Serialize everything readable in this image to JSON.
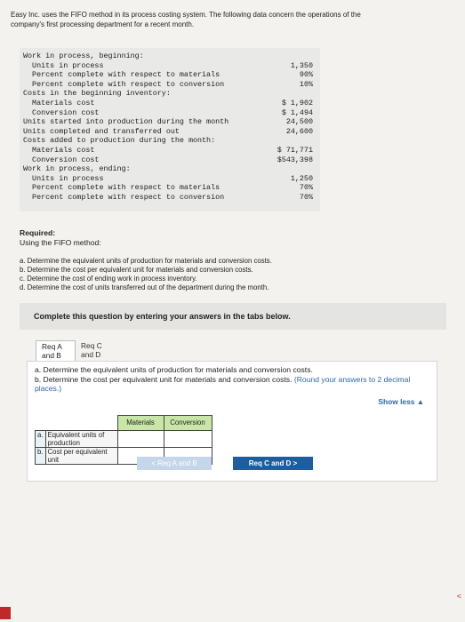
{
  "intro": {
    "line1": "Easy Inc. uses the FIFO method in its process costing system. The following data concern the operations of the",
    "line2": "company's first processing department for a recent month."
  },
  "data_rows": [
    {
      "label": "Work in process, beginning:",
      "value": "",
      "indent": 0
    },
    {
      "label": "  Units in process",
      "value": "1,350",
      "indent": 0
    },
    {
      "label": "  Percent complete with respect to materials",
      "value": "90%",
      "indent": 0
    },
    {
      "label": "  Percent complete with respect to conversion",
      "value": "10%",
      "indent": 0
    },
    {
      "label": "Costs in the beginning inventory:",
      "value": "",
      "indent": 0
    },
    {
      "label": "  Materials cost",
      "value": "$ 1,902",
      "indent": 0
    },
    {
      "label": "  Conversion cost",
      "value": "$ 1,494",
      "indent": 0
    },
    {
      "label": "Units started into production during the month",
      "value": "24,500",
      "indent": 0
    },
    {
      "label": "Units completed and transferred out",
      "value": "24,600",
      "indent": 0
    },
    {
      "label": "Costs added to production during the month:",
      "value": "",
      "indent": 0
    },
    {
      "label": "  Materials cost",
      "value": "$ 71,771",
      "indent": 0
    },
    {
      "label": "  Conversion cost",
      "value": "$543,398",
      "indent": 0
    },
    {
      "label": "Work in process, ending:",
      "value": "",
      "indent": 0
    },
    {
      "label": "  Units in process",
      "value": "1,250",
      "indent": 0
    },
    {
      "label": "  Percent complete with respect to materials",
      "value": "70%",
      "indent": 0
    },
    {
      "label": "  Percent complete with respect to conversion",
      "value": "70%",
      "indent": 0
    }
  ],
  "required": {
    "heading": "Required:",
    "subheading": "Using the FIFO method:",
    "items": [
      "a. Determine the equivalent units of production for materials and conversion costs.",
      "b. Determine the cost per equivalent unit for materials and conversion costs.",
      "c. Determine the cost of ending work in process inventory.",
      "d. Determine the cost of units transferred out of the department during the month."
    ]
  },
  "panel_title": "Complete this question by entering your answers in the tabs below.",
  "tabs": [
    {
      "line1": "Req A",
      "line2": "and B"
    },
    {
      "line1": "Req C",
      "line2": "and D"
    }
  ],
  "question": {
    "text": "a. Determine the equivalent units of production for materials and conversion costs.",
    "text2": "b. Determine the cost per equivalent unit for materials and conversion costs.",
    "hint": "(Round your answers to 2 decimal places.)",
    "show_less": "Show less ▲"
  },
  "answer_table": {
    "col_materials": "Materials",
    "col_conversion": "Conversion",
    "rows": [
      {
        "key": "a.",
        "label": "Equivalent units of production"
      },
      {
        "key": "b.",
        "label": "Cost per equivalent unit"
      }
    ]
  },
  "nav": {
    "prev": "< Req A and B",
    "next": "Req C and D  >"
  },
  "colors": {
    "accent_blue": "#1f5e9e",
    "header_green": "#c9e6a9",
    "corner_red": "#c0282c"
  }
}
